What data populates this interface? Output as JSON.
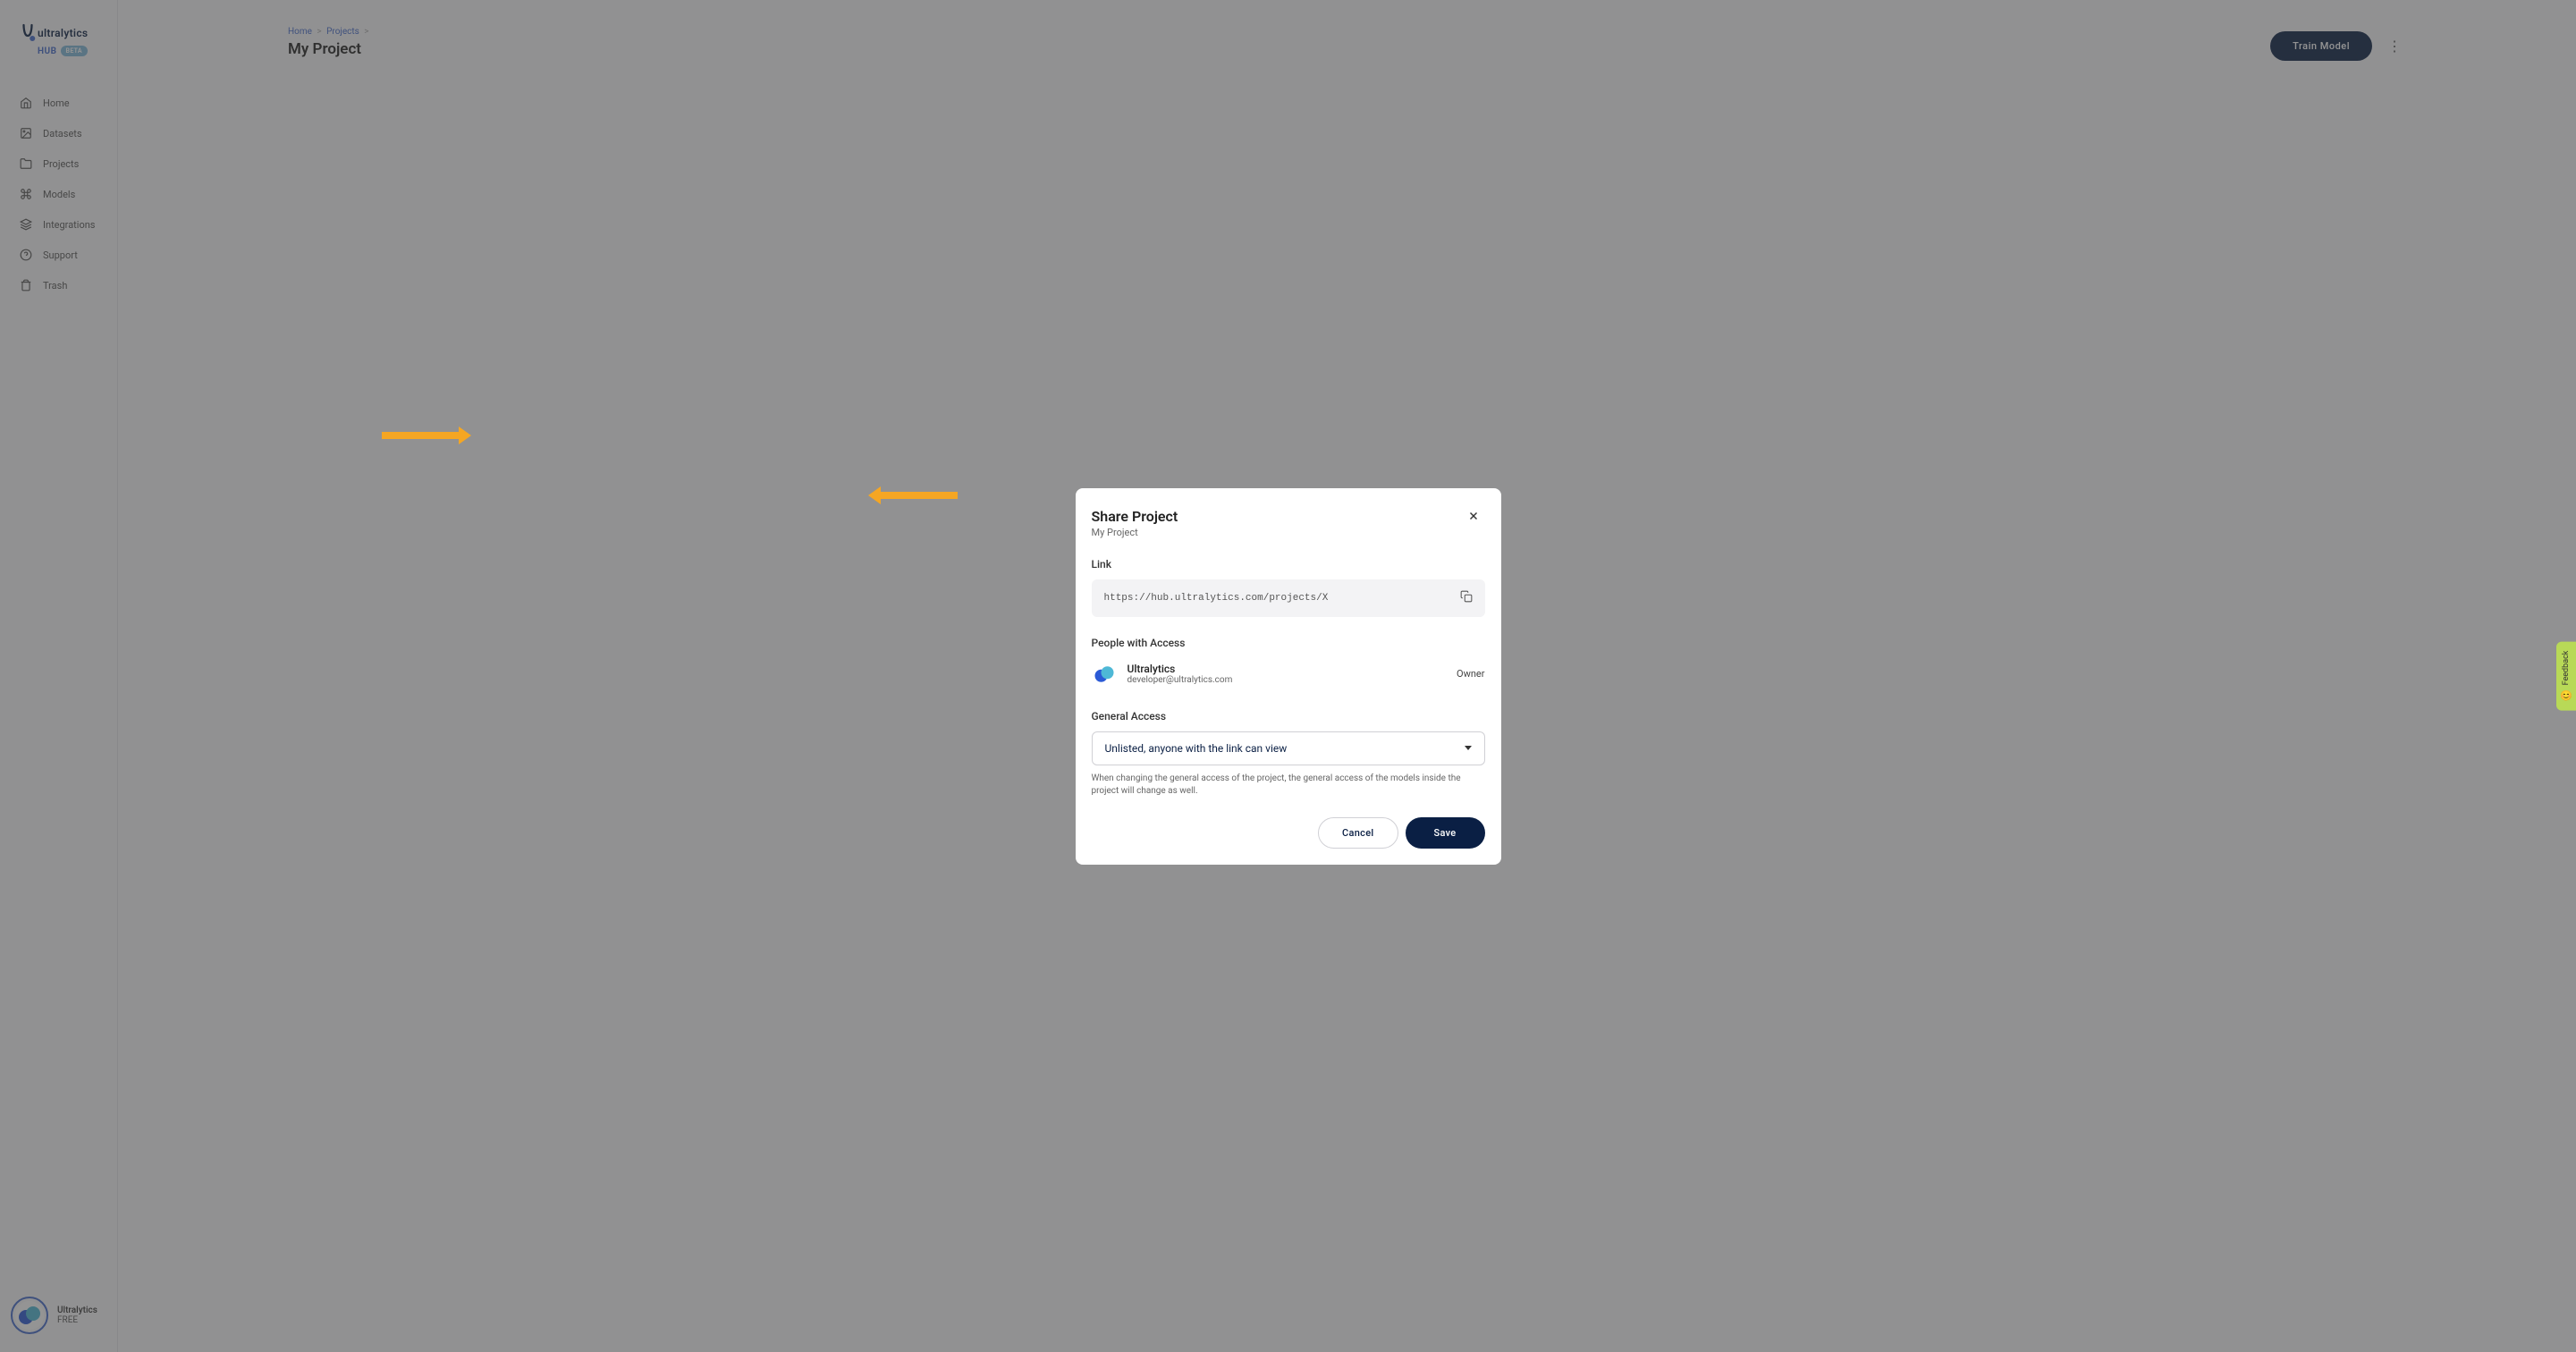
{
  "brand": {
    "name": "ultralytics",
    "hub": "HUB",
    "beta": "BETA"
  },
  "sidebar": {
    "items": [
      {
        "label": "Home"
      },
      {
        "label": "Datasets"
      },
      {
        "label": "Projects"
      },
      {
        "label": "Models"
      },
      {
        "label": "Integrations"
      },
      {
        "label": "Support"
      },
      {
        "label": "Trash"
      }
    ]
  },
  "user": {
    "name": "Ultralytics",
    "plan": "FREE"
  },
  "breadcrumb": {
    "home": "Home",
    "projects": "Projects"
  },
  "page": {
    "title": "My Project",
    "train_button": "Train Model"
  },
  "dialog": {
    "title": "Share Project",
    "subtitle": "My Project",
    "link_label": "Link",
    "link_value": "https://hub.ultralytics.com/projects/X",
    "people_label": "People with Access",
    "person": {
      "name": "Ultralytics",
      "email": "developer@ultralytics.com",
      "role": "Owner"
    },
    "access_label": "General Access",
    "access_value": "Unlisted, anyone with the link can view",
    "access_note": "When changing the general access of the project, the general access of the models inside the project will change as well.",
    "cancel": "Cancel",
    "save": "Save"
  },
  "feedback": {
    "label": "Feedback"
  }
}
